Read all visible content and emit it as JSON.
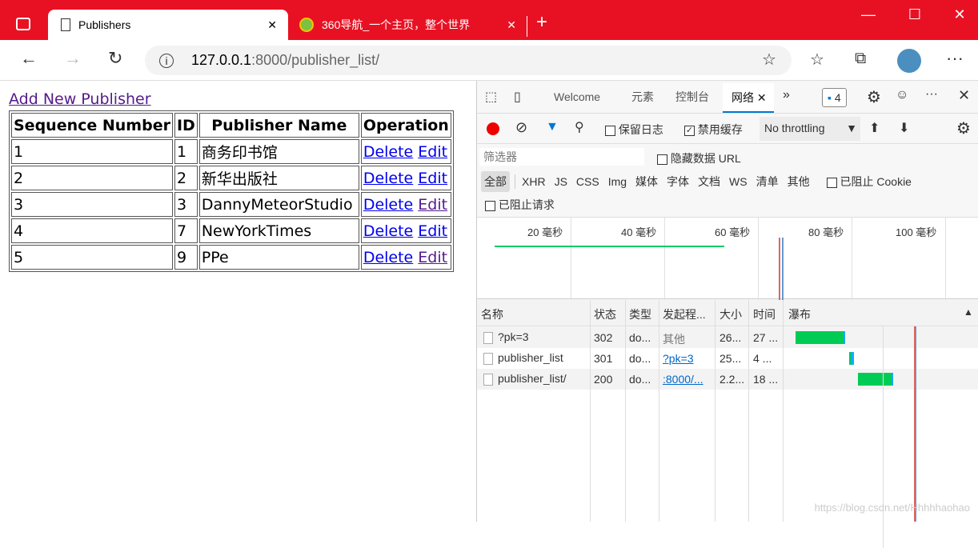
{
  "browser": {
    "tabs": [
      {
        "title": "Publishers",
        "active": true
      },
      {
        "title": "360导航_一个主页，整个世界",
        "active": false
      }
    ],
    "url_host": "127.0.0.1",
    "url_path": ":8000/publisher_list/",
    "accent": "#e81123"
  },
  "page": {
    "add_link": "Add New Publisher",
    "headers": [
      "Sequence Number",
      "ID",
      "Publisher Name",
      "Operation"
    ],
    "rows": [
      {
        "seq": "1",
        "id": "1",
        "name": "商务印书馆",
        "delete": "Delete",
        "edit": "Edit"
      },
      {
        "seq": "2",
        "id": "2",
        "name": "新华出版社",
        "delete": "Delete",
        "edit": "Edit"
      },
      {
        "seq": "3",
        "id": "3",
        "name": "DannyMeteorStudio",
        "delete": "Delete",
        "edit": "Edit"
      },
      {
        "seq": "4",
        "id": "7",
        "name": "NewYorkTimes",
        "delete": "Delete",
        "edit": "Edit"
      },
      {
        "seq": "5",
        "id": "9",
        "name": "PPe",
        "delete": "Delete",
        "edit": "Edit"
      }
    ]
  },
  "devtools": {
    "tabs": [
      "Welcome",
      "元素",
      "控制台",
      "网络"
    ],
    "issues_count": "4",
    "preserve_log": "保留日志",
    "disable_cache": "禁用缓存",
    "throttling": "No throttling",
    "filter_placeholder": "筛选器",
    "hide_data_urls": "隐藏数据 URL",
    "types": [
      "全部",
      "XHR",
      "JS",
      "CSS",
      "Img",
      "媒体",
      "字体",
      "文档",
      "WS",
      "清单",
      "其他"
    ],
    "blocked_cookies": "已阻止 Cookie",
    "blocked_requests": "已阻止请求",
    "ticks": [
      "20 毫秒",
      "40 毫秒",
      "60 毫秒",
      "80 毫秒",
      "100 毫秒"
    ],
    "columns": [
      "名称",
      "状态",
      "类型",
      "发起程...",
      "大小",
      "时间",
      "瀑布"
    ],
    "requests": [
      {
        "name": "?pk=3",
        "status": "302",
        "type": "do...",
        "initiator": "其他",
        "size": "26...",
        "time": "27 ..."
      },
      {
        "name": "publisher_list",
        "status": "301",
        "type": "do...",
        "initiator": "?pk=3",
        "size": "25...",
        "time": "4 ..."
      },
      {
        "name": "publisher_list/",
        "status": "200",
        "type": "do...",
        "initiator": ":8000/...",
        "size": "2.2...",
        "time": "18 ..."
      }
    ]
  },
  "watermark": "https://blog.csdn.net/Hhhhhaohao"
}
